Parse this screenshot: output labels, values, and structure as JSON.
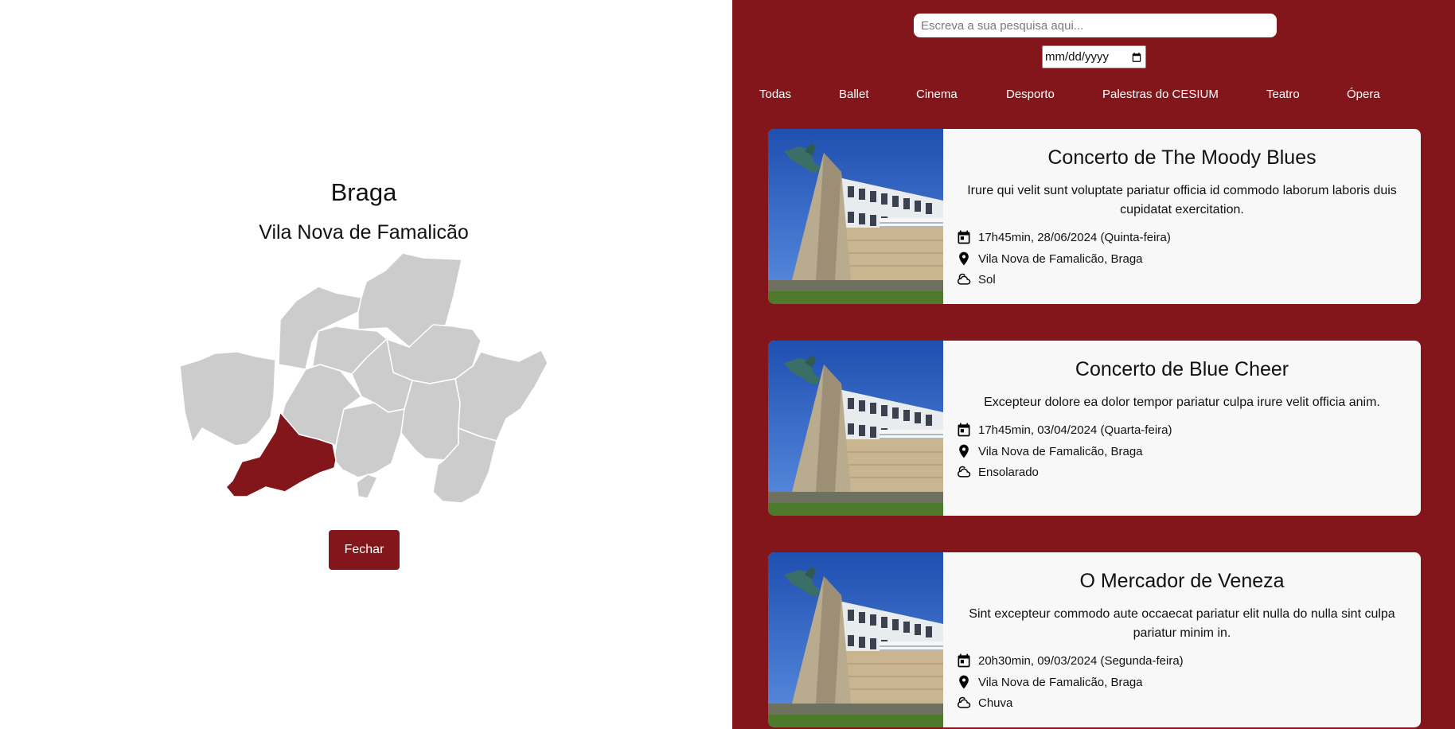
{
  "map_panel": {
    "district": "Braga",
    "municipality": "Vila Nova de Famalicão",
    "close_label": "Fechar",
    "highlight_color": "#82161a",
    "region_color": "#cccccc"
  },
  "search": {
    "placeholder": "Escreva a sua pesquisa aqui..."
  },
  "date_filter": {
    "value": "mm/dd/yyyy",
    "icon": "calendar-icon"
  },
  "categories": [
    "Todas",
    "Ballet",
    "Cinema",
    "Desporto",
    "Palestras do CESIUM",
    "Teatro",
    "Ópera"
  ],
  "events": [
    {
      "title": "Concerto de The Moody Blues",
      "description": "Irure qui velit sunt voluptate pariatur officia id commodo laborum laboris duis cupidatat exercitation.",
      "datetime": "17h45min, 28/06/2024 (Quinta-feira)",
      "location": "Vila Nova de Famalicão, Braga",
      "weather": "Sol"
    },
    {
      "title": "Concerto de Blue Cheer",
      "description": "Excepteur dolore ea dolor tempor pariatur culpa irure velit officia anim.",
      "datetime": "17h45min, 03/04/2024 (Quarta-feira)",
      "location": "Vila Nova de Famalicão, Braga",
      "weather": "Ensolarado"
    },
    {
      "title": "O Mercador de Veneza",
      "description": "Sint excepteur commodo aute occaecat pariatur elit nulla do nulla sint culpa pariatur minim in.",
      "datetime": "20h30min, 09/03/2024 (Segunda-feira)",
      "location": "Vila Nova de Famalicão, Braga",
      "weather": "Chuva"
    }
  ],
  "theme": {
    "accent": "#82161a",
    "card_background": "#f8f8f8"
  }
}
